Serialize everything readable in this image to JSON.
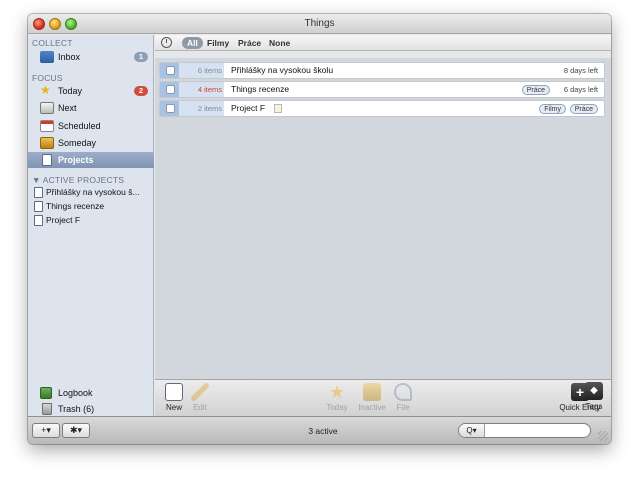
{
  "window": {
    "title": "Things"
  },
  "sidebar": {
    "collect_label": "COLLECT",
    "inbox": {
      "label": "Inbox",
      "badge": "1"
    },
    "focus_label": "FOCUS",
    "focus_items": [
      {
        "label": "Today",
        "badge": "2"
      },
      {
        "label": "Next"
      },
      {
        "label": "Scheduled"
      },
      {
        "label": "Someday"
      },
      {
        "label": "Projects"
      }
    ],
    "active_projects_label": "▼ ACTIVE PROJECTS",
    "projects": [
      {
        "label": "Přihlášky na vysokou š..."
      },
      {
        "label": "Things recenze"
      },
      {
        "label": "Project F"
      }
    ],
    "logbook": "Logbook",
    "trash": "Trash (6)"
  },
  "filterbar": {
    "tags": [
      "All",
      "Filmy",
      "Práce",
      "None"
    ],
    "selected": "All"
  },
  "projects_list": [
    {
      "count": "6 items",
      "name": "Přihlášky na vysokou školu",
      "tags": [],
      "due": "8 days left"
    },
    {
      "count": "4 items",
      "name": "Things recenze",
      "tags": [
        "Práce"
      ],
      "due": "6 days left"
    },
    {
      "count": "2 items",
      "name": "Project F",
      "tags": [
        "Filmy",
        "Práce"
      ],
      "due": "",
      "has_note": true
    }
  ],
  "toolbar": {
    "new": "New",
    "edit": "Edit",
    "today": "Today",
    "inactive": "Inactive",
    "file": "File",
    "quick_entry": "Quick Entry",
    "tags": "Tags"
  },
  "statusbar": {
    "add_button": "+▾",
    "action_button": "✱▾",
    "status": "3 active",
    "search_mode": "Q▾",
    "search_value": ""
  },
  "colors": {
    "selection": "#8a9dbb",
    "badge_red": "#d24b3f",
    "badge_blue": "#8d9fb9",
    "count_red": "#cc4438"
  }
}
